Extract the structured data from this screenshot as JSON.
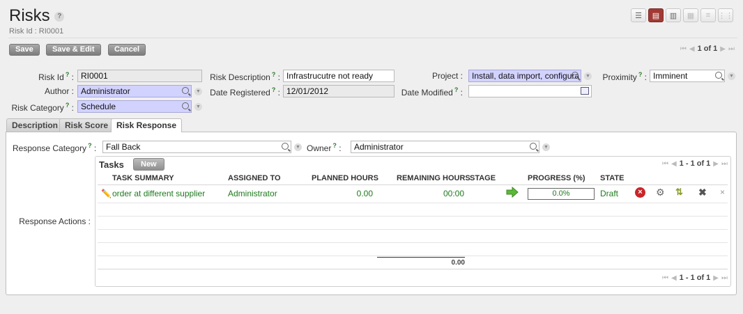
{
  "header": {
    "title": "Risks",
    "help": "?",
    "subtitle": "Risk Id : RI0001"
  },
  "view_switcher": [
    "list-view-icon",
    "form-view-icon",
    "graph-view-icon",
    "calendar-view-icon",
    "gantt-view-icon",
    "grid-view-icon"
  ],
  "toolbar": {
    "save_label": "Save",
    "save_edit_label": "Save & Edit",
    "cancel_label": "Cancel",
    "pager_text": "1 of 1"
  },
  "form": {
    "risk_id_label": "Risk Id",
    "risk_id_value": "RI0001",
    "risk_description_label": "Risk Description",
    "risk_description_value": "Infrastrucutre not ready",
    "project_label": "Project",
    "project_value": "Install, data import, configura",
    "proximity_label": "Proximity",
    "proximity_value": "Imminent",
    "author_label": "Author",
    "author_value": "Administrator",
    "date_registered_label": "Date Registered",
    "date_registered_value": "12/01/2012",
    "date_modified_label": "Date Modified",
    "date_modified_value": "",
    "risk_category_label": "Risk Category",
    "risk_category_value": "Schedule",
    "help_mark": "?",
    "colon": ":"
  },
  "tabs": [
    {
      "label": "Description",
      "active": false
    },
    {
      "label": "Risk Score",
      "active": false
    },
    {
      "label": "Risk Response",
      "active": true
    }
  ],
  "risk_response": {
    "response_category_label": "Response Category",
    "response_category_value": "Fall Back",
    "owner_label": "Owner",
    "owner_value": "Administrator",
    "response_actions_label": "Response Actions :"
  },
  "tasks": {
    "title": "Tasks",
    "new_label": "New",
    "pager_text": "1 - 1 of 1",
    "columns": [
      "TASK SUMMARY",
      "ASSIGNED TO",
      "PLANNED HOURS",
      "REMAINING HOURS",
      "STAGE",
      "PROGRESS (%)",
      "STATE"
    ],
    "rows": [
      {
        "summary": "order at different supplier",
        "assigned_to": "Administrator",
        "planned_hours": "0.00",
        "remaining_hours": "00:00",
        "progress": "0.0%",
        "state": "Draft"
      }
    ],
    "planned_total": "0.00",
    "footer_pager_text": "1 - 1 of 1"
  }
}
